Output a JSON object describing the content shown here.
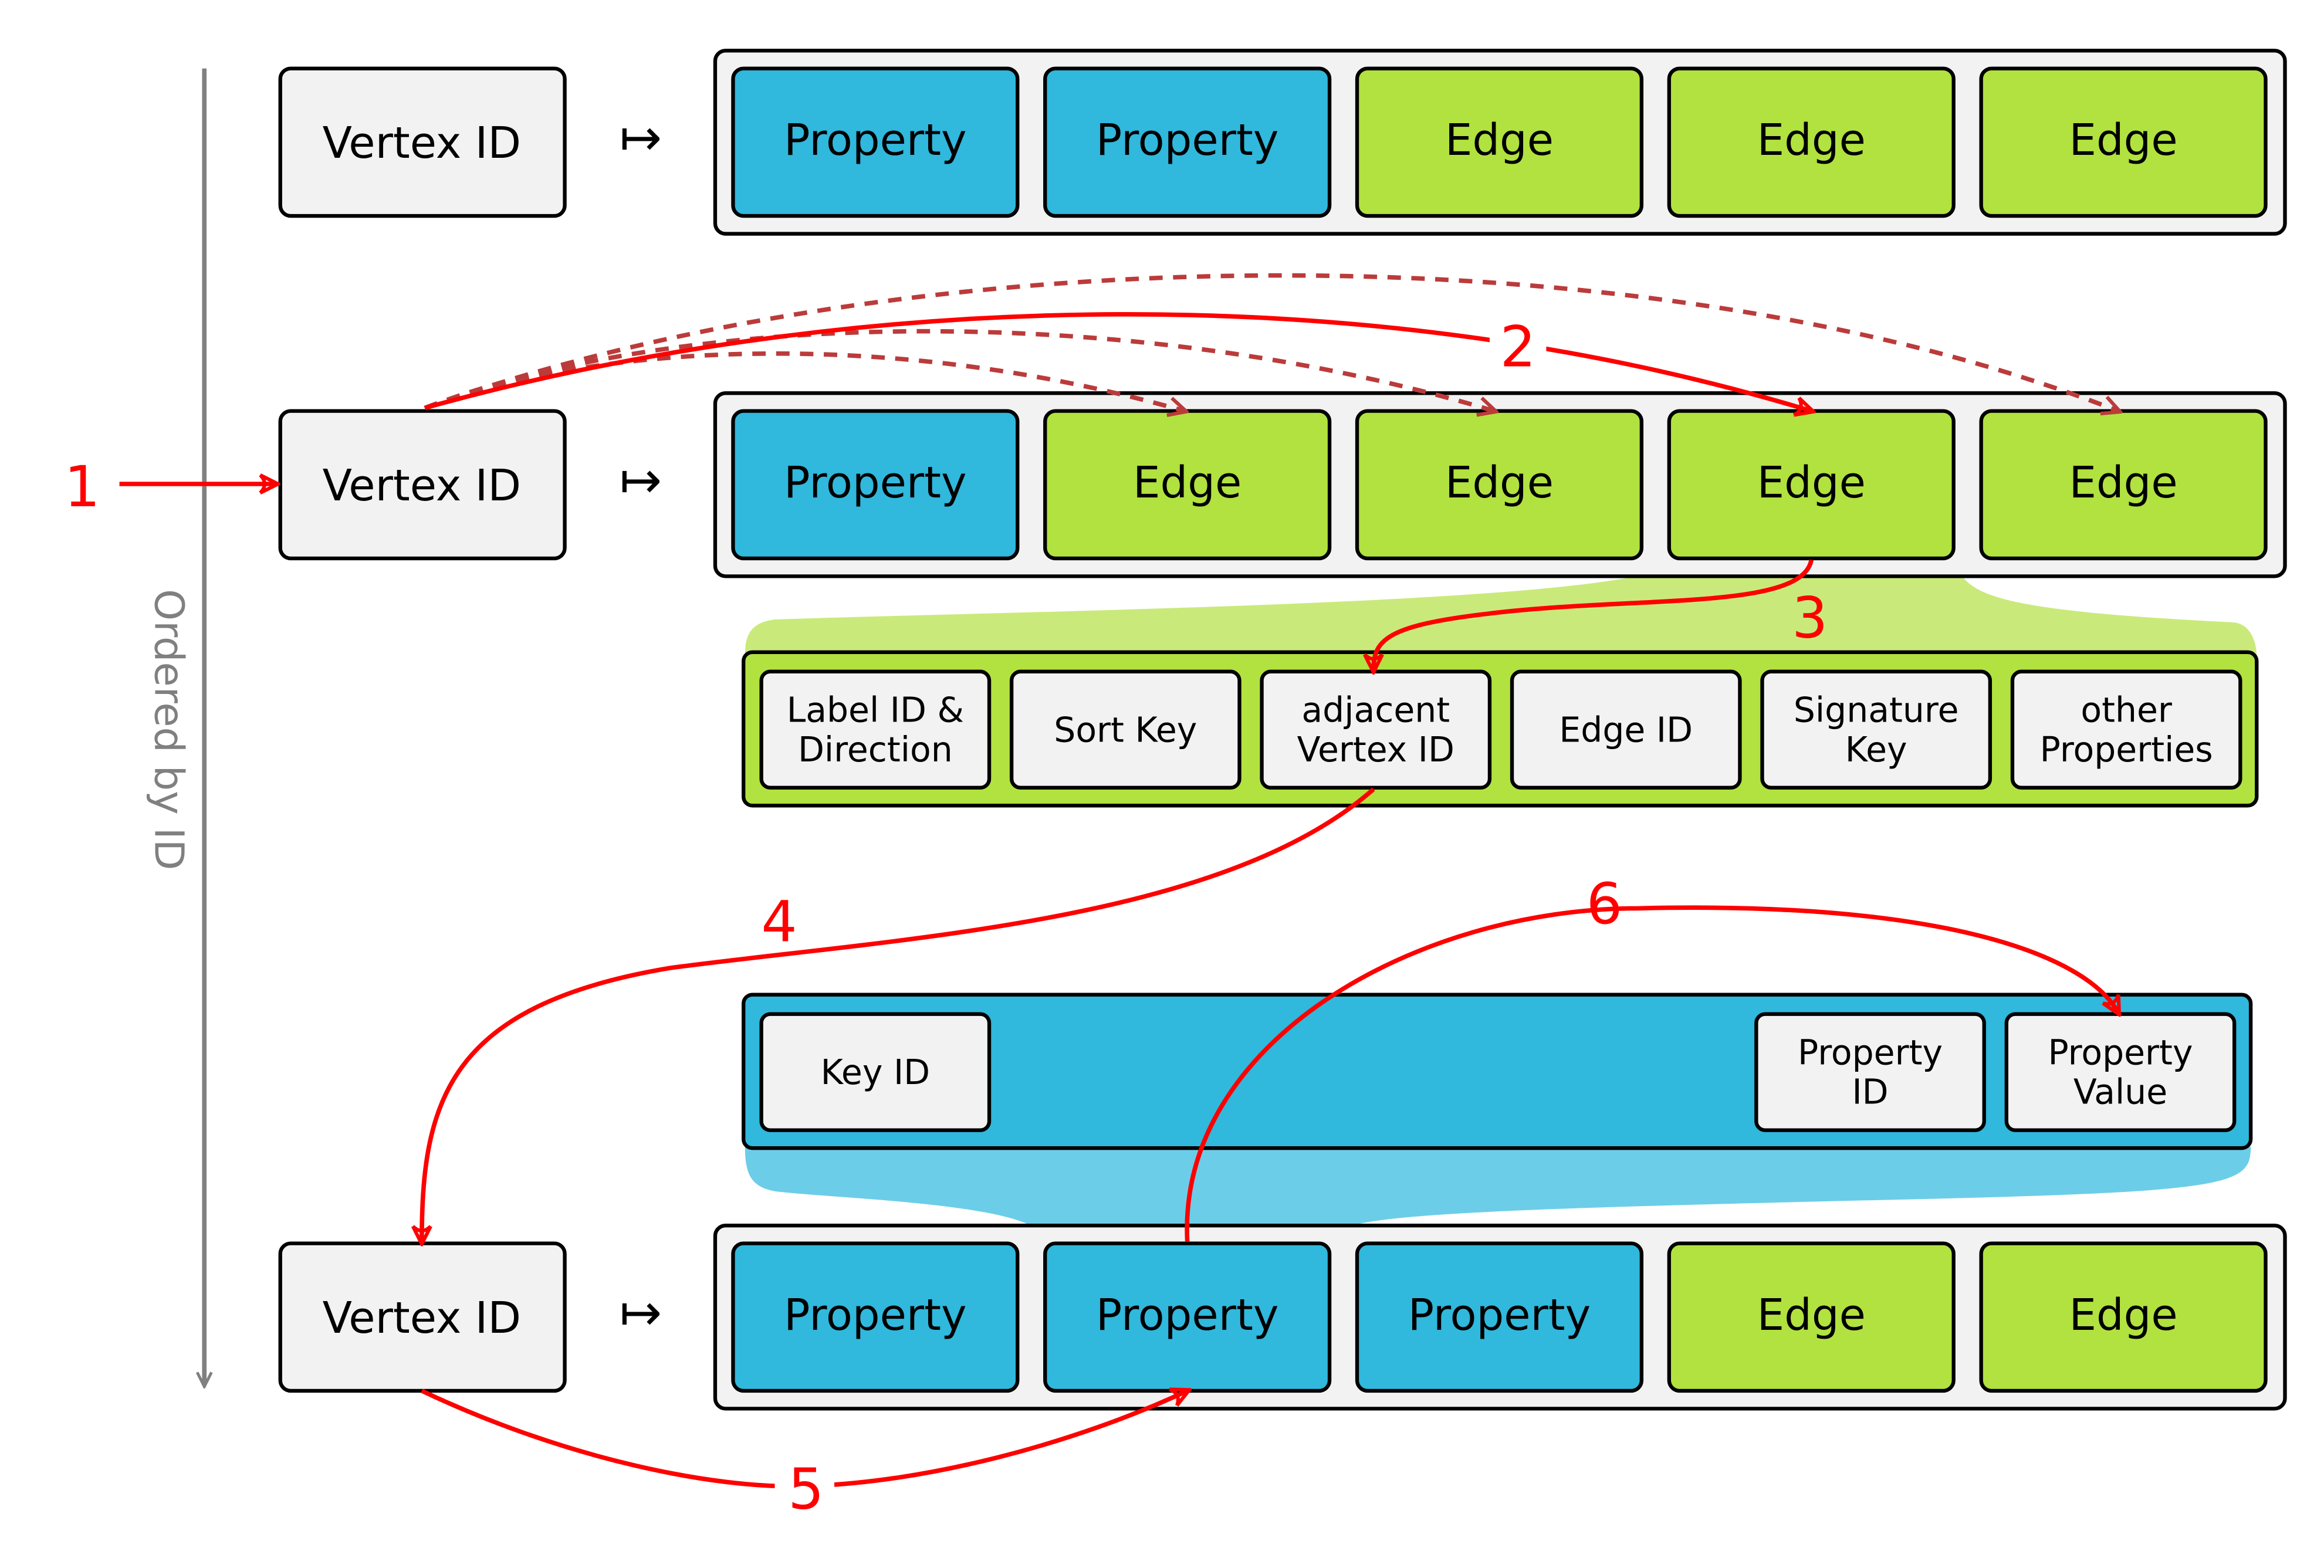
{
  "colors": {
    "property": "#30b8dd",
    "edge": "#b1e23f",
    "neutral": "#f2f2f2",
    "edge_callout": "#c9ea7a",
    "property_callout": "#6ccde8",
    "red": "#ff0000",
    "dashed": "#bb3b3b",
    "axis": "#808080"
  },
  "axis_label": "Ordered by ID",
  "maps_to": "↦",
  "rows": [
    {
      "key": "Vertex ID",
      "cells": [
        {
          "type": "property",
          "label": "Property"
        },
        {
          "type": "property",
          "label": "Property"
        },
        {
          "type": "edge",
          "label": "Edge"
        },
        {
          "type": "edge",
          "label": "Edge"
        },
        {
          "type": "edge",
          "label": "Edge"
        }
      ]
    },
    {
      "key": "Vertex ID",
      "cells": [
        {
          "type": "property",
          "label": "Property"
        },
        {
          "type": "edge",
          "label": "Edge"
        },
        {
          "type": "edge",
          "label": "Edge"
        },
        {
          "type": "edge",
          "label": "Edge"
        },
        {
          "type": "edge",
          "label": "Edge"
        }
      ]
    },
    {
      "key": "Vertex ID",
      "cells": [
        {
          "type": "property",
          "label": "Property"
        },
        {
          "type": "property",
          "label": "Property"
        },
        {
          "type": "property",
          "label": "Property"
        },
        {
          "type": "edge",
          "label": "Edge"
        },
        {
          "type": "edge",
          "label": "Edge"
        }
      ]
    }
  ],
  "edge_detail": [
    [
      "Label ID &",
      "Direction"
    ],
    [
      "Sort Key"
    ],
    [
      "adjacent",
      "Vertex ID"
    ],
    [
      "Edge ID"
    ],
    [
      "Signature",
      "Key"
    ],
    [
      "other",
      "Properties"
    ]
  ],
  "property_detail": {
    "left": [
      [
        "Key ID"
      ]
    ],
    "right": [
      [
        "Property",
        "ID"
      ],
      [
        "Property",
        "Value"
      ]
    ]
  },
  "steps": [
    "1",
    "2",
    "3",
    "4",
    "5",
    "6"
  ]
}
